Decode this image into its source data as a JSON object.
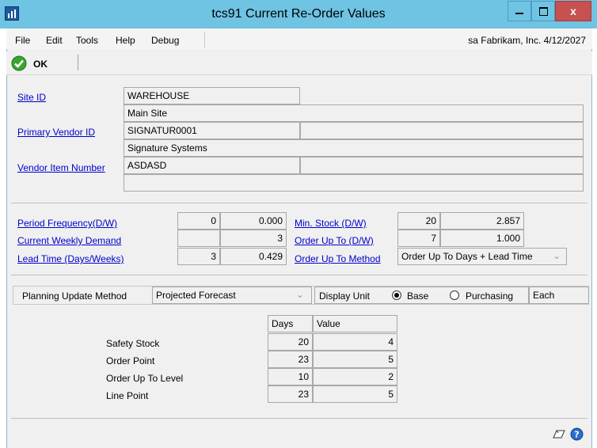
{
  "window": {
    "title": "tcs91 Current Re-Order Values",
    "app_icon": "app-icon",
    "close_label": "x"
  },
  "menu": {
    "items": [
      "File",
      "Edit",
      "Tools",
      "Help",
      "Debug"
    ],
    "company_info": "sa  Fabrikam, Inc. 4/12/2027"
  },
  "toolbar": {
    "ok_label": "OK",
    "ok_icon": "checkmark-icon"
  },
  "site": {
    "site_id_label": "Site ID",
    "site_id_value": "WAREHOUSE",
    "site_desc": "Main Site",
    "vendor_label": "Primary Vendor ID",
    "vendor_value": "SIGNATUR0001",
    "vendor_name": "Signature Systems",
    "item_label": "Vendor Item Number",
    "item_value": "ASDASD",
    "item_desc": ""
  },
  "params": {
    "period_label": "Period Frequency(D/W)",
    "period_val": "0",
    "period_val2": "0.000",
    "demand_label": "Current Weekly Demand",
    "demand_val": "3",
    "lead_label": " Lead Time (Days/Weeks)",
    "lead_val": "3",
    "lead_val2": "0.429",
    "minstock_label": "Min. Stock (D/W)",
    "minstock_val": "20",
    "minstock_val2": "2.857",
    "orderupto_label": "Order Up To (D/W)",
    "orderupto_val": "7",
    "orderupto_val2": "1.000",
    "method_label": "Order Up To Method",
    "method_value": "Order Up To Days + Lead Time"
  },
  "planning": {
    "label": "Planning Update Method",
    "value": "Projected Forecast",
    "display_unit_label": "Display Unit",
    "base_label": "Base",
    "purchasing_label": "Purchasing",
    "unit_value": "Each",
    "selected": "Base"
  },
  "table": {
    "headers": [
      "Days",
      "Value"
    ],
    "rows": [
      {
        "label": "Safety Stock",
        "days": "20",
        "value": "4"
      },
      {
        "label": "Order Point",
        "days": "23",
        "value": "5"
      },
      {
        "label": "Order Up To Level",
        "days": "10",
        "value": "2"
      },
      {
        "label": "Line Point",
        "days": "23",
        "value": "5"
      }
    ]
  },
  "status_icons": [
    "note-icon",
    "help-icon"
  ]
}
